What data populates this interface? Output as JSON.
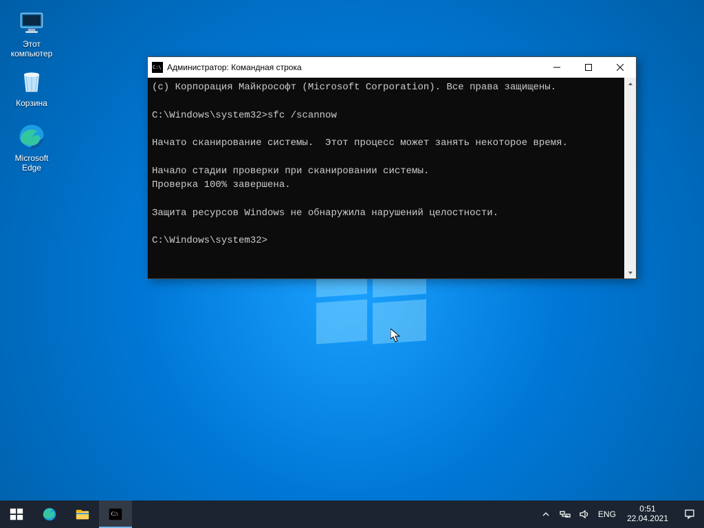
{
  "desktop_icons": {
    "this_pc": {
      "label": "Этот компьютер"
    },
    "recycle": {
      "label": "Корзина"
    },
    "edge": {
      "label": "Microsoft Edge"
    }
  },
  "window": {
    "title": "Администратор: Командная строка"
  },
  "terminal": {
    "lines": [
      "(c) Корпорация Майкрософт (Microsoft Corporation). Все права защищены.",
      "",
      "C:\\Windows\\system32>sfc /scannow",
      "",
      "Начато сканирование системы.  Этот процесс может занять некоторое время.",
      "",
      "Начало стадии проверки при сканировании системы.",
      "Проверка 100% завершена.",
      "",
      "Защита ресурсов Windows не обнаружила нарушений целостности.",
      "",
      "C:\\Windows\\system32>"
    ]
  },
  "tray": {
    "language": "ENG",
    "time": "0:51",
    "date": "22.04.2021"
  }
}
